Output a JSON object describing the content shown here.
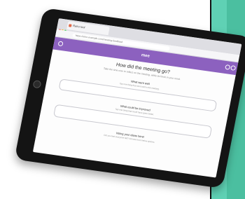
{
  "browser": {
    "tab_title": "Retro tool",
    "url": "https://retro.example.com/meeting-feedback"
  },
  "app": {
    "logo_text": "mee"
  },
  "form": {
    "title": "How did the meeting go?",
    "subtitle": "Take the time now to reflect on the meeting, while its fresh in your mind.",
    "questions": [
      {
        "label": "What went well",
        "hint": "Tap one thing that went well in the meeting."
      },
      {
        "label": "What could be improved",
        "hint": "Tap one thing that could have gone better."
      },
      {
        "label": "Voting your ideas here!",
        "hint": "Did you feel everyone felt? Choose from below options."
      }
    ]
  },
  "colors": {
    "accent": "#8c61bf",
    "background_panel": "#4bbfa0",
    "bezel": "#141414"
  }
}
